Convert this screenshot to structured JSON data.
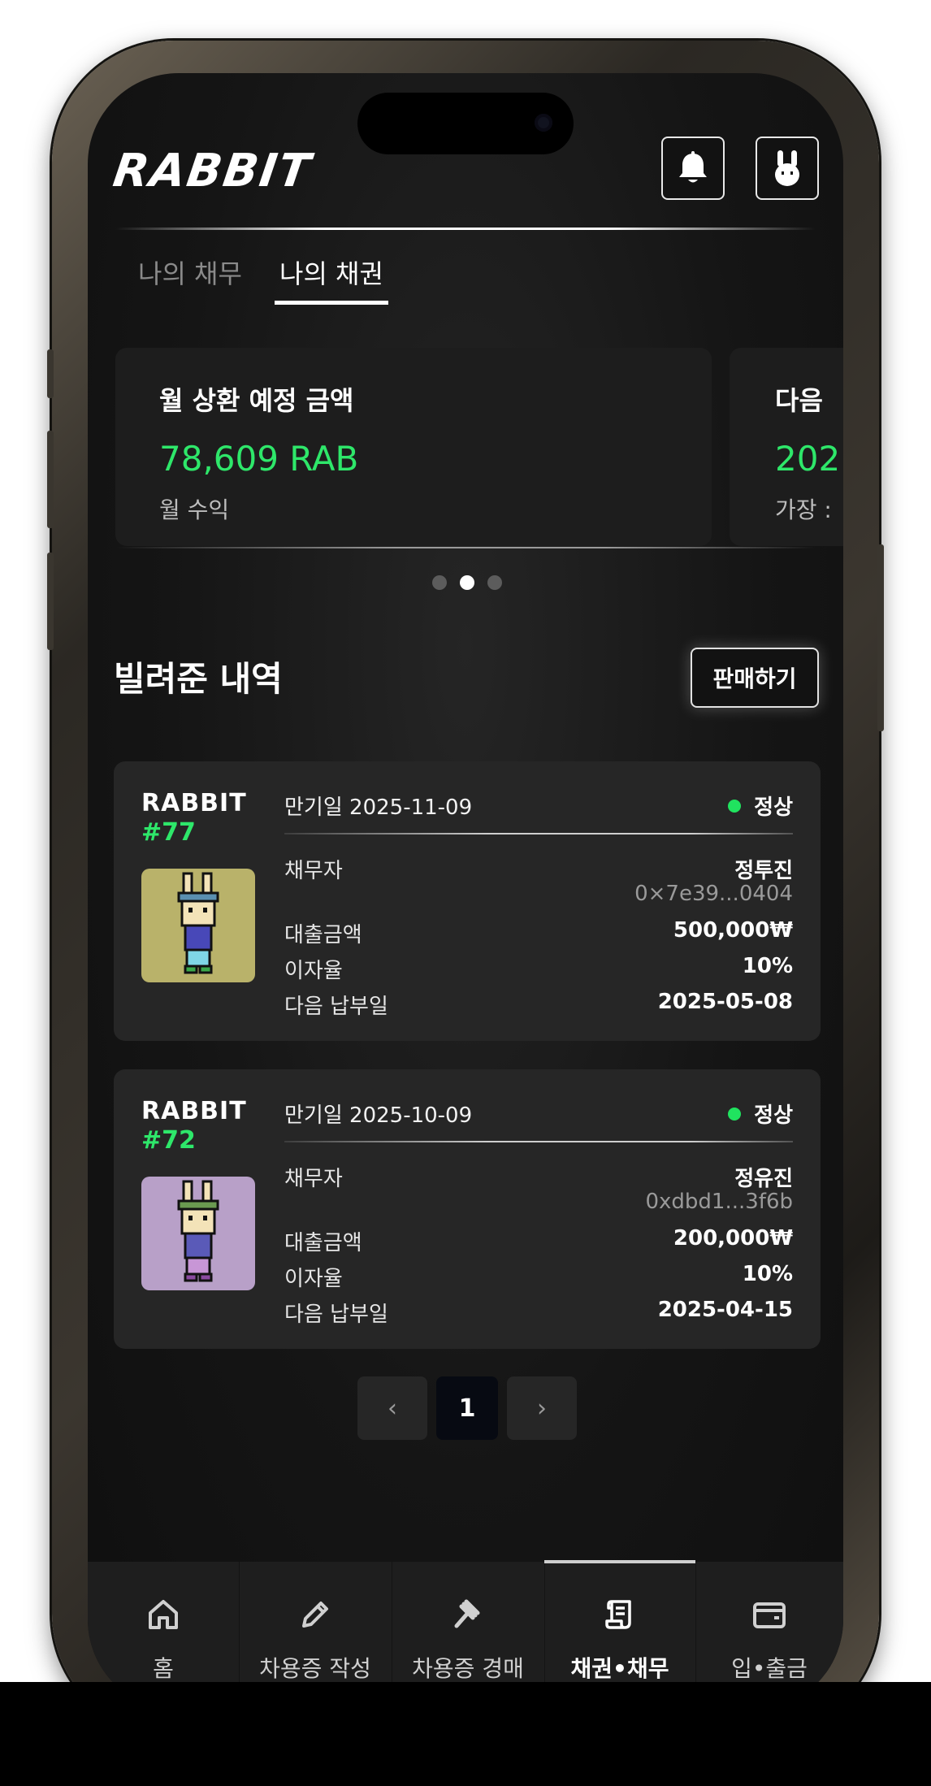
{
  "header": {
    "logo_text": "RABBIT"
  },
  "tabs": [
    {
      "label": "나의 채무",
      "active": false
    },
    {
      "label": "나의 채권",
      "active": true
    }
  ],
  "summary_cards": [
    {
      "title": "월 상환 예정 금액",
      "value": "78,609 RAB",
      "sub": "월 수익"
    },
    {
      "title": "다음",
      "value": "202",
      "sub": "가장 :"
    }
  ],
  "carousel": {
    "dots": 3,
    "active_index": 1
  },
  "section": {
    "title": "빌려준 내역",
    "sell_button": "판매하기"
  },
  "loans": [
    {
      "nft_name": "RABBIT",
      "nft_number": "#77",
      "due_label": "만기일 2025-11-09",
      "status": "정상",
      "debtor_label": "채무자",
      "debtor_name": "정투진",
      "debtor_address": "0×7e39...0404",
      "amount_label": "대출금액",
      "amount": "500,000₩",
      "rate_label": "이자율",
      "rate": "10%",
      "next_label": "다음 납부일",
      "next_date": "2025-05-08",
      "image_bg": "#b9b26a",
      "hat_color": "#5a8fb0",
      "shirt_color": "#4848b8",
      "pants_color": "#7fd6e6"
    },
    {
      "nft_name": "RABBIT",
      "nft_number": "#72",
      "due_label": "만기일 2025-10-09",
      "status": "정상",
      "debtor_label": "채무자",
      "debtor_name": "정유진",
      "debtor_address": "0xdbd1...3f6b",
      "amount_label": "대출금액",
      "amount": "200,000₩",
      "rate_label": "이자율",
      "rate": "10%",
      "next_label": "다음 납부일",
      "next_date": "2025-04-15",
      "image_bg": "#b8a0c8",
      "hat_color": "#6a9a50",
      "shirt_color": "#5a5ab8",
      "pants_color": "#c896d6"
    }
  ],
  "pagination": {
    "prev": "‹",
    "current": "1",
    "next": "›"
  },
  "bottom_nav": [
    {
      "label": "홈",
      "icon": "home-icon",
      "active": false
    },
    {
      "label": "차용증 작성",
      "icon": "pencil-icon",
      "active": false
    },
    {
      "label": "차용증 경매",
      "icon": "gavel-icon",
      "active": false
    },
    {
      "label": "채권•채무",
      "icon": "scroll-icon",
      "active": true
    },
    {
      "label": "입•출금",
      "icon": "wallet-icon",
      "active": false
    }
  ],
  "colors": {
    "accent_green": "#2ee76a",
    "status_green": "#20e35f",
    "background": "#151515",
    "card": "#262626"
  }
}
